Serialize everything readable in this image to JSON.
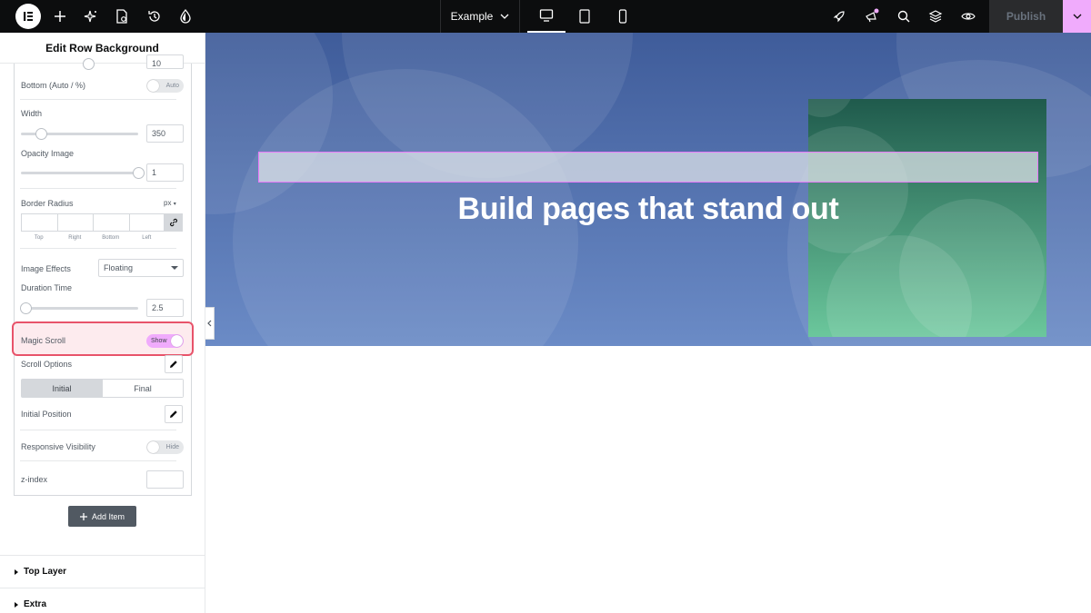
{
  "topbar": {
    "page_name": "Example",
    "publish_label": "Publish",
    "colors": {
      "background": "#0c0d0e",
      "accent": "#f0abfc"
    },
    "icons": [
      "elementor-logo-icon",
      "plus-icon",
      "ai-sparkle-icon",
      "page-settings-icon",
      "history-icon",
      "theme-style-icon",
      "rocket-icon",
      "megaphone-icon",
      "search-icon",
      "layers-icon",
      "preview-eye-icon"
    ]
  },
  "panel": {
    "title": "Edit Row Background",
    "partial_value": "10",
    "bottom_label": "Bottom (Auto / %)",
    "bottom_toggle": "Auto",
    "width_label": "Width",
    "width_value": "350",
    "opacity_label": "Opacity Image",
    "opacity_value": "1",
    "border_radius_label": "Border Radius",
    "border_radius_unit": "px",
    "dims": [
      "Top",
      "Right",
      "Bottom",
      "Left"
    ],
    "image_effects_label": "Image Effects",
    "image_effects_value": "Floating",
    "duration_label": "Duration Time",
    "duration_value": "2.5",
    "magic_scroll_label": "Magic Scroll",
    "magic_scroll_toggle": "Show",
    "scroll_options_label": "Scroll Options",
    "tabs": [
      "Initial",
      "Final"
    ],
    "initial_position_label": "Initial Position",
    "responsive_label": "Responsive Visibility",
    "responsive_toggle": "Hide",
    "zindex_label": "z-index",
    "add_item_label": "Add Item",
    "sections": [
      "Top Layer",
      "Extra"
    ]
  },
  "canvas": {
    "headline": "Build pages that stand out"
  }
}
